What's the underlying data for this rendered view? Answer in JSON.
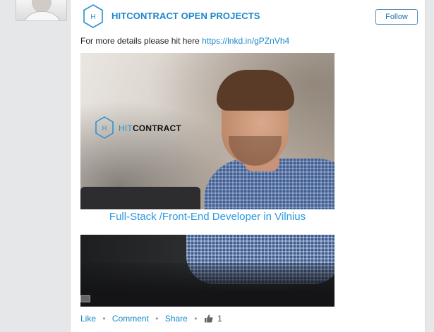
{
  "company": {
    "name": "HITCONTRACT OPEN PROJECTS",
    "logo_letter": "H"
  },
  "follow_label": "Follow",
  "post": {
    "text": "For more details please hit here",
    "link": "https://lnkd.in/gPZnVh4"
  },
  "hero": {
    "brand_hit": "HIT",
    "brand_contract": "CONTRACT",
    "logo_letter": "H"
  },
  "job_title": "Full-Stack /Front-End Developer in Vilnius",
  "actions": {
    "like": "Like",
    "comment": "Comment",
    "share": "Share",
    "separator": "•",
    "like_count": "1"
  },
  "icons": {
    "company_logo": "hexagon-logo-icon",
    "thumbs_up": "thumbs-up-icon"
  },
  "colors": {
    "brand_blue": "#1a87c9",
    "link_blue": "#2a9ae0"
  }
}
